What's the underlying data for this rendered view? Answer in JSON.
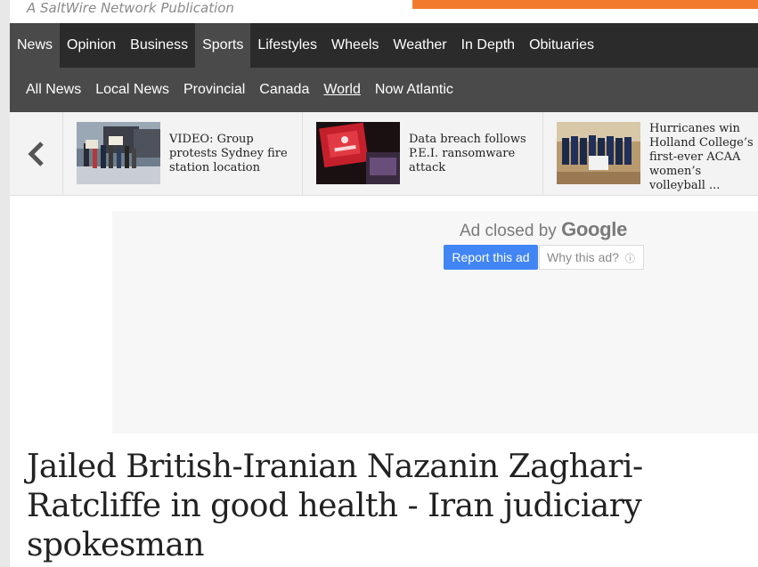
{
  "header": {
    "tagline": "A SaltWire Network Publication",
    "banner_color": "#f27a2c"
  },
  "main_nav": {
    "items": [
      {
        "label": "News",
        "active": true
      },
      {
        "label": "Opinion",
        "active": false
      },
      {
        "label": "Business",
        "active": false
      },
      {
        "label": "Sports",
        "active": true
      },
      {
        "label": "Lifestyles",
        "active": false
      },
      {
        "label": "Wheels",
        "active": false
      },
      {
        "label": "Weather",
        "active": false
      },
      {
        "label": "In Depth",
        "active": false
      },
      {
        "label": "Obituaries",
        "active": false
      }
    ]
  },
  "sub_nav": {
    "items": [
      {
        "label": "All News"
      },
      {
        "label": "Local News"
      },
      {
        "label": "Provincial"
      },
      {
        "label": "Canada"
      },
      {
        "label": "World",
        "current": true
      },
      {
        "label": "Now Atlantic"
      }
    ]
  },
  "carousel": {
    "prev_icon": "chevron-left-icon",
    "stories": [
      {
        "headline": "VIDEO: Group protests Sydney fire station location"
      },
      {
        "headline": "Data breach follows P.E.I. ransomware attack"
      },
      {
        "headline": "Hurricanes win Holland College’s first-ever ACAA women’s volleyball ..."
      }
    ]
  },
  "ad": {
    "closed_text": "Ad closed by",
    "brand": "Google",
    "report_label": "Report this ad",
    "why_label": "Why this ad?",
    "info_icon": "info-icon"
  },
  "article": {
    "title": "Jailed British-Iranian Nazanin Zaghari-Ratcliffe in good health - Iran judiciary spokesman"
  }
}
